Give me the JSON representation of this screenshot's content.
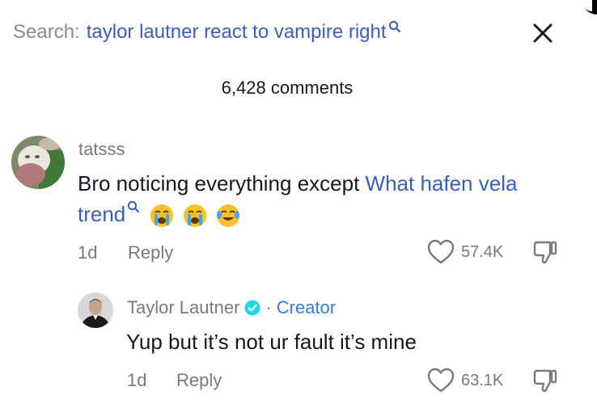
{
  "search": {
    "prefix": "Search:",
    "query": "taylor lautner react to vampire right"
  },
  "comments_count": "6,428 comments",
  "comments": [
    {
      "username": "tatsss",
      "text": "Bro noticing everything except ",
      "link_text": "What hafen vela trend",
      "time": "1d",
      "reply_label": "Reply",
      "likes": "57.4K",
      "emojis": [
        "loudly-crying-face",
        "loudly-crying-face",
        "face-with-tears-of-joy"
      ]
    },
    {
      "username": "Taylor Lautner",
      "separator": "·",
      "creator_label": "Creator",
      "text": "Yup but it’s not ur fault it’s mine",
      "time": "1d",
      "reply_label": "Reply",
      "likes": "63.1K"
    }
  ]
}
